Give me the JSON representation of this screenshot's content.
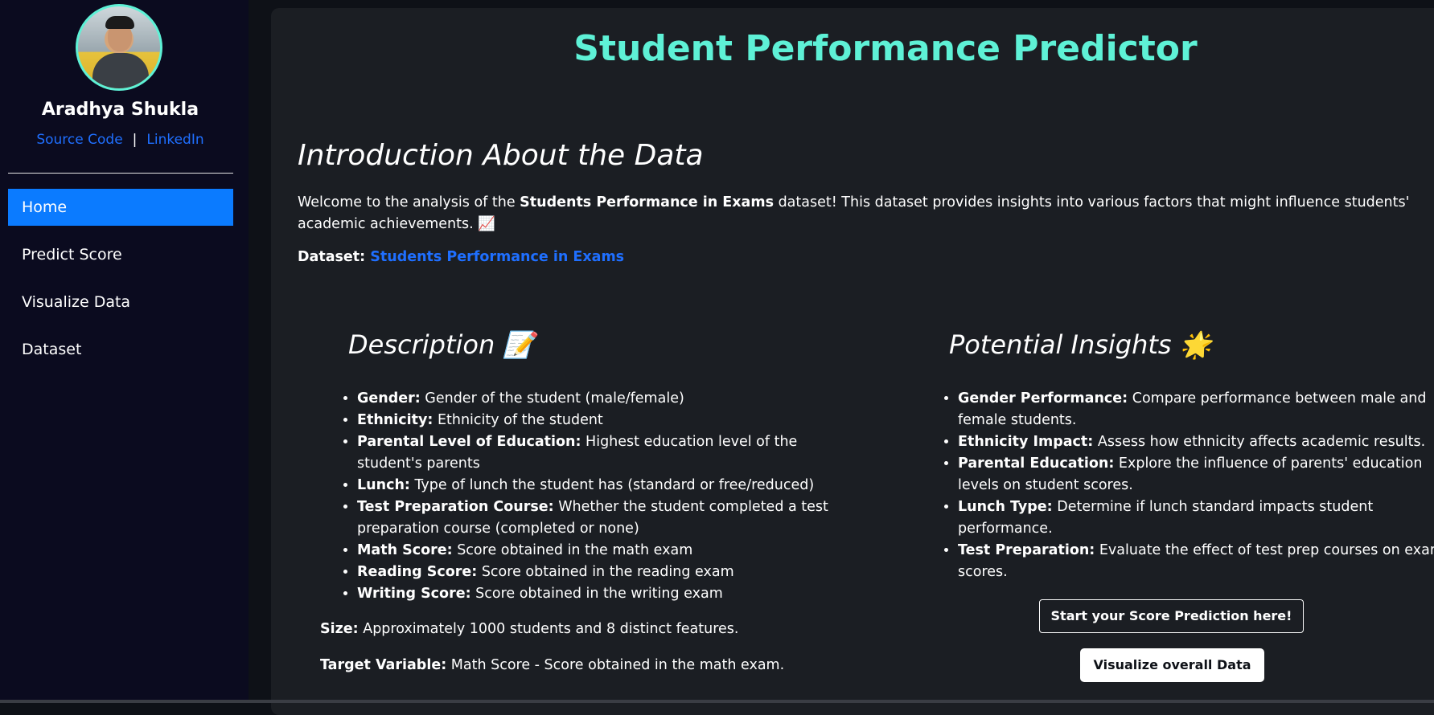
{
  "sidebar": {
    "name": "Aradhya Shukla",
    "source_code_label": "Source Code",
    "separator": "|",
    "linkedin_label": "LinkedIn",
    "nav": [
      {
        "label": "Home",
        "active": true
      },
      {
        "label": "Predict Score",
        "active": false
      },
      {
        "label": "Visualize Data",
        "active": false
      },
      {
        "label": "Dataset",
        "active": false
      }
    ]
  },
  "main": {
    "title": "Student Performance Predictor",
    "intro_heading": "Introduction About the Data",
    "intro_text_pre": "Welcome to the analysis of the ",
    "intro_text_bold": "Students Performance in Exams",
    "intro_text_post": " dataset! This dataset provides insights into various factors that might influence students' academic achievements. 📈",
    "dataset_label": "Dataset:",
    "dataset_link": "Students Performance in Exams",
    "description_heading": "Description 📝",
    "description_items": [
      {
        "key": "Gender:",
        "text": " Gender of the student (male/female)"
      },
      {
        "key": "Ethnicity:",
        "text": " Ethnicity of the student"
      },
      {
        "key": "Parental Level of Education:",
        "text": " Highest education level of the student's parents"
      },
      {
        "key": "Lunch:",
        "text": " Type of lunch the student has (standard or free/reduced)"
      },
      {
        "key": "Test Preparation Course:",
        "text": " Whether the student completed a test preparation course (completed or none)"
      },
      {
        "key": "Math Score:",
        "text": " Score obtained in the math exam"
      },
      {
        "key": "Reading Score:",
        "text": " Score obtained in the reading exam"
      },
      {
        "key": "Writing Score:",
        "text": " Score obtained in the writing exam"
      }
    ],
    "size_label": "Size:",
    "size_text": " Approximately 1000 students and 8 distinct features.",
    "target_label": "Target Variable:",
    "target_text": " Math Score - Score obtained in the math exam.",
    "insights_heading": "Potential Insights 🌟",
    "insights_items": [
      {
        "key": "Gender Performance:",
        "text": " Compare performance between male and female students."
      },
      {
        "key": "Ethnicity Impact:",
        "text": " Assess how ethnicity affects academic results."
      },
      {
        "key": "Parental Education:",
        "text": " Explore the influence of parents' education levels on student scores."
      },
      {
        "key": "Lunch Type:",
        "text": " Determine if lunch standard impacts student performance."
      },
      {
        "key": "Test Preparation:",
        "text": " Evaluate the effect of test prep courses on exam scores."
      }
    ],
    "predict_button": "Start your Score Prediction here!",
    "visualize_button": "Visualize overall Data"
  }
}
